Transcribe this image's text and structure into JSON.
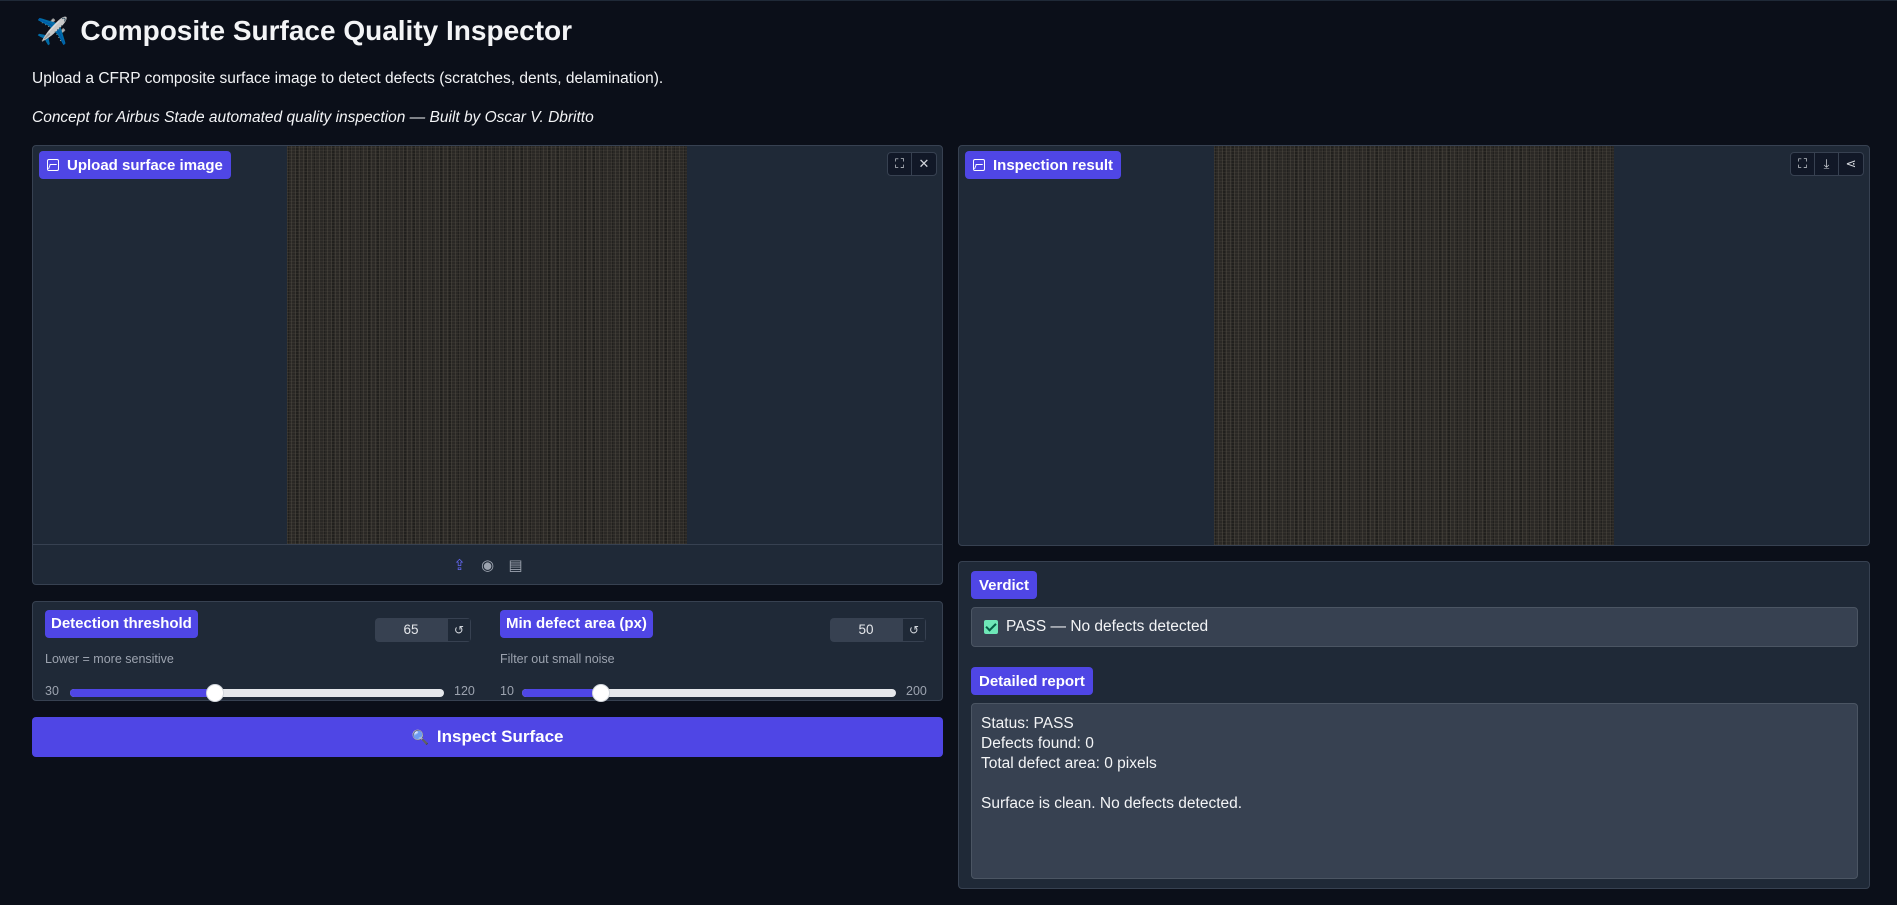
{
  "header": {
    "icon": "airplane-icon",
    "title": "Composite Surface Quality Inspector",
    "subtitle": "Upload a CFRP composite surface image to detect defects (scratches, dents, delamination).",
    "credit": "Concept for Airbus Stade automated quality inspection — Built by Oscar V. Dbritto"
  },
  "upload": {
    "label": "Upload surface image",
    "tools": [
      "fullscreen-icon",
      "close-icon"
    ],
    "sources": [
      "upload-icon",
      "webcam-icon",
      "clipboard-icon"
    ]
  },
  "result": {
    "label": "Inspection result",
    "tools": [
      "fullscreen-icon",
      "download-icon",
      "share-icon"
    ]
  },
  "controls": {
    "threshold": {
      "label": "Detection threshold",
      "info": "Lower = more sensitive",
      "value": "65",
      "min": "30",
      "max": "120",
      "fraction": 0.389
    },
    "min_area": {
      "label": "Min defect area (px)",
      "info": "Filter out small noise",
      "value": "50",
      "min": "10",
      "max": "200",
      "fraction": 0.21
    },
    "reset_glyph": "↺"
  },
  "inspect_button": {
    "icon": "magnifier-icon",
    "label": "Inspect Surface"
  },
  "verdict": {
    "label": "Verdict",
    "text": "PASS — No defects detected"
  },
  "report": {
    "label": "Detailed report",
    "lines": [
      "Status: PASS",
      "Defects found: 0",
      "Total defect area: 0 pixels",
      "",
      "Surface is clean. No defects detected."
    ]
  },
  "colors": {
    "accent": "#4f46e5",
    "background": "#0b0f19",
    "panel": "#1f2937",
    "pass": "#6ee7b7"
  }
}
